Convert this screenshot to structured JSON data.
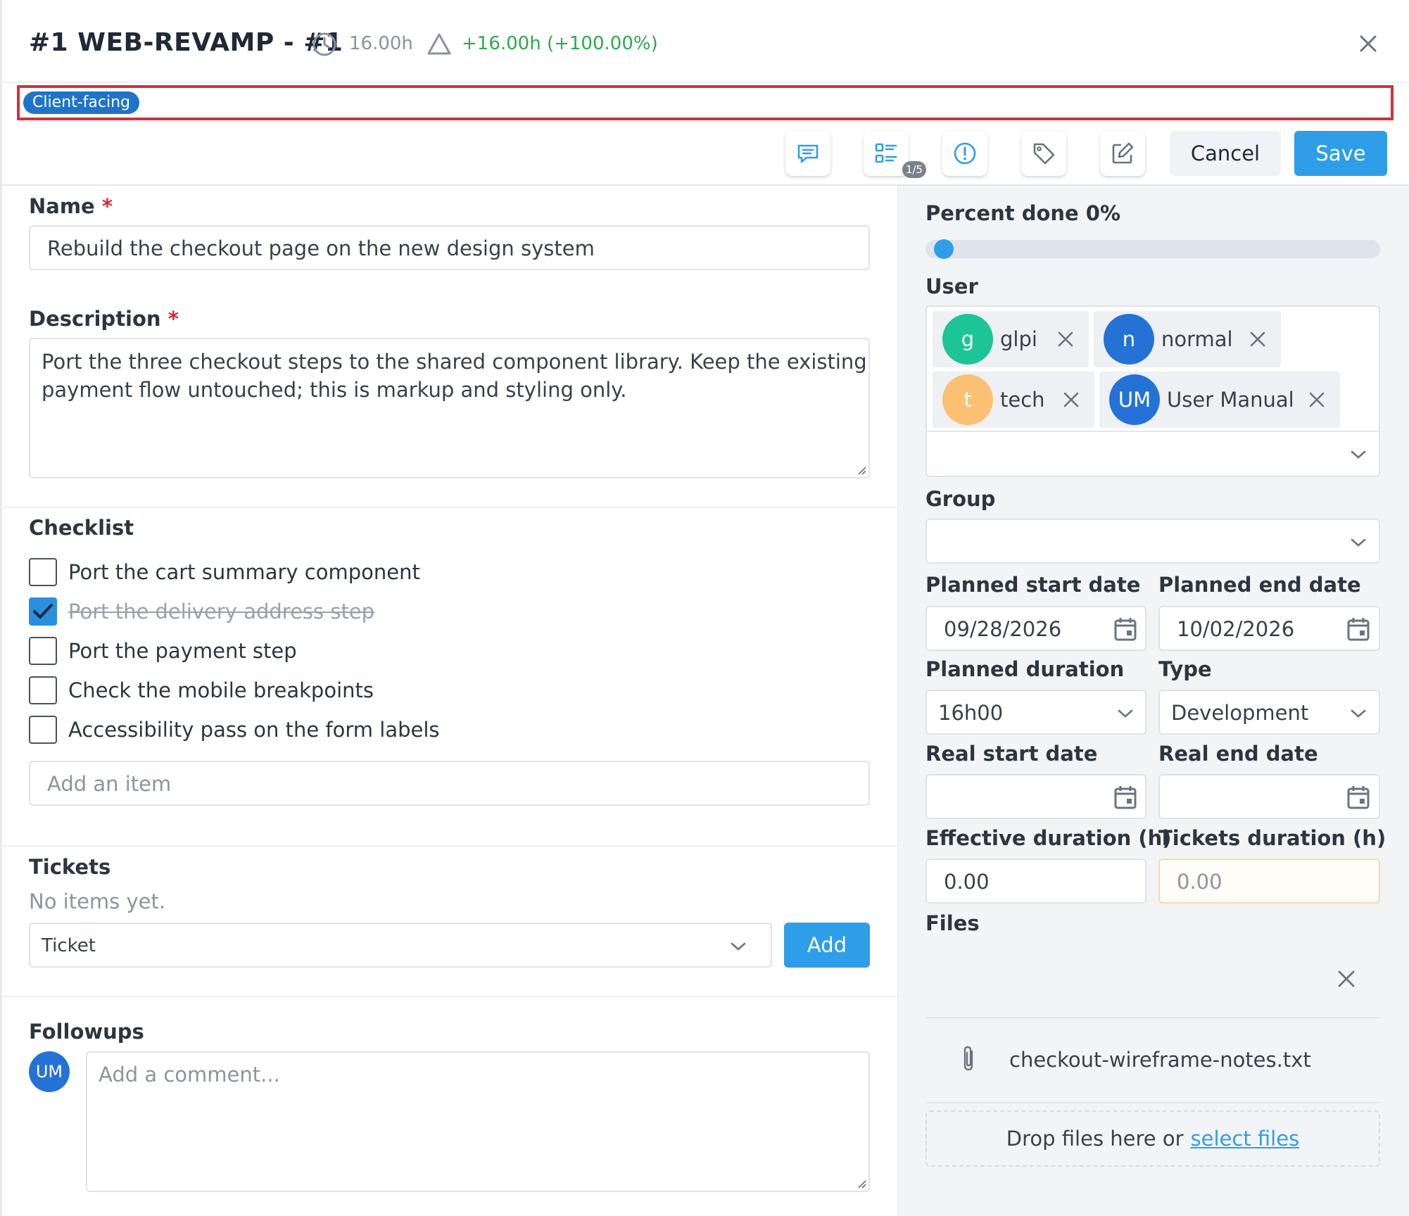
{
  "header": {
    "title": "#1 WEB-REVAMP - #1",
    "planned_hours": "16.00h",
    "delta": "+16.00h (+100.00%)",
    "tags": [
      "Client-facing"
    ]
  },
  "toolbar": {
    "checklist_badge": "1/5",
    "cancel_label": "Cancel",
    "save_label": "Save",
    "icons": [
      "comment-icon",
      "checklist-icon",
      "alert-icon",
      "tag-icon",
      "edit-icon"
    ]
  },
  "form": {
    "name_label": "Name",
    "required_mark": "*",
    "name_value": "Rebuild the checkout page on the new design system",
    "description_label": "Description",
    "description_line1": "Port the three checkout steps to the shared component library. Keep the existing",
    "description_line2": "payment flow untouched; this is markup and styling only.",
    "checklist_label": "Checklist",
    "checklist_items": [
      {
        "label": "Port the cart summary component",
        "checked": false
      },
      {
        "label": "Port the delivery address step",
        "checked": true
      },
      {
        "label": "Port the payment step",
        "checked": false
      },
      {
        "label": "Check the mobile breakpoints",
        "checked": false
      },
      {
        "label": "Accessibility pass on the form labels",
        "checked": false
      }
    ],
    "add_item_placeholder": "Add an item",
    "tickets_label": "Tickets",
    "tickets_empty": "No items yet.",
    "ticket_select_value": "Ticket",
    "add_ticket_label": "Add",
    "followups_label": "Followups",
    "followup_avatar": "UM",
    "comment_placeholder": "Add a comment..."
  },
  "side": {
    "percent_done_label": "Percent done 0%",
    "percent_done_value": 0,
    "user_label": "User",
    "users": [
      {
        "initial": "g",
        "name": "glpi",
        "color": "#1cc497"
      },
      {
        "initial": "n",
        "name": "normal",
        "color": "#2472d6"
      },
      {
        "initial": "t",
        "name": "tech",
        "color": "#fcc073"
      },
      {
        "initial": "UM",
        "name": "User Manual",
        "color": "#2472d6"
      }
    ],
    "group_label": "Group",
    "planned_start_label": "Planned start date",
    "planned_start_value": "09/28/2026",
    "planned_end_label": "Planned end date",
    "planned_end_value": "10/02/2026",
    "planned_duration_label": "Planned duration",
    "planned_duration_value": "16h00",
    "type_label": "Type",
    "type_value": "Development",
    "real_start_label": "Real start date",
    "real_end_label": "Real end date",
    "effective_duration_label": "Effective duration (h)",
    "effective_duration_value": "0.00",
    "tickets_duration_label": "Tickets duration (h)",
    "tickets_duration_value": "0.00",
    "files_label": "Files",
    "file_name": "checkout-wireframe-notes.txt",
    "drop_text": "Drop files here or",
    "select_files_link": "select files"
  },
  "colors": {
    "accent": "#2f9ee8",
    "tag": "#1f74c9",
    "delta_green": "#2fa84f",
    "required_red": "#e0242b",
    "highlight_box": "#d3313a"
  }
}
